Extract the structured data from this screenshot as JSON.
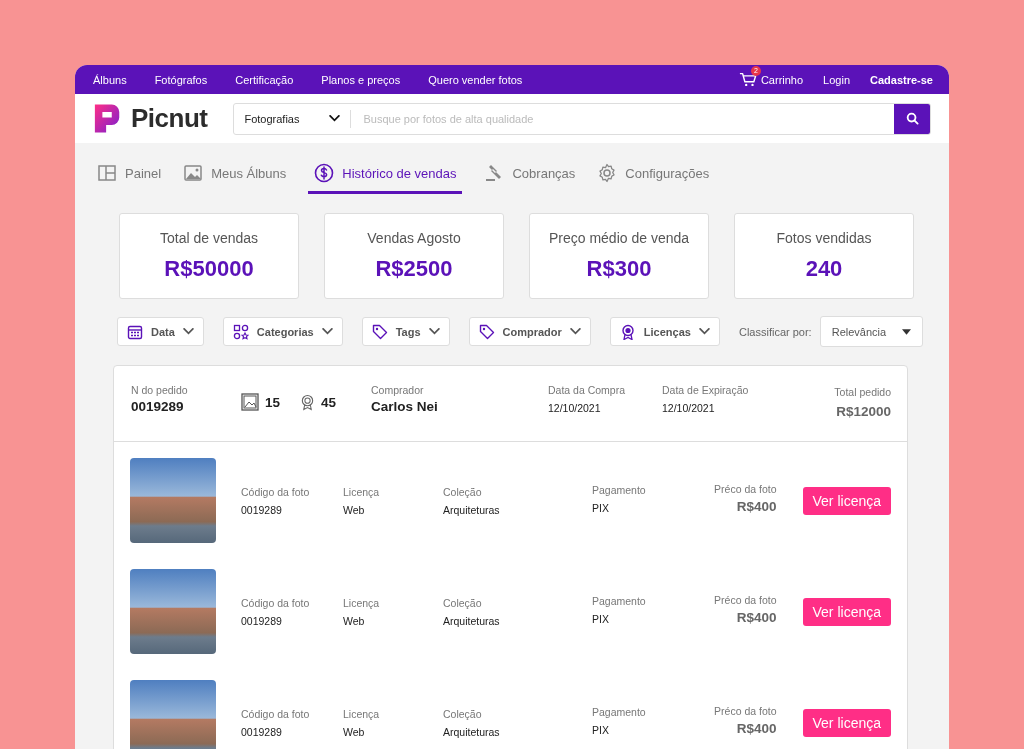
{
  "nav_links": [
    "Álbuns",
    "Fotógrafos",
    "Certificação",
    "Planos e preços",
    "Quero vender fotos"
  ],
  "cart": {
    "label": "Carrinho",
    "badge": "2"
  },
  "login": "Login",
  "signup": "Cadastre-se",
  "logo": "Picnut",
  "search": {
    "category": "Fotografias",
    "placeholder": "Busque por fotos de alta qualidade"
  },
  "tabs": [
    {
      "label": "Painel",
      "kind": "panel",
      "selected": false
    },
    {
      "label": "Meus Álbuns",
      "kind": "album",
      "selected": false
    },
    {
      "label": "Histórico de vendas",
      "kind": "dollar",
      "selected": true
    },
    {
      "label": "Cobranças",
      "kind": "gavel",
      "selected": false
    },
    {
      "label": "Configurações",
      "kind": "gear",
      "selected": false
    }
  ],
  "stats": [
    {
      "label": "Total de vendas",
      "value": "R$50000"
    },
    {
      "label": "Vendas Agosto",
      "value": "R$2500"
    },
    {
      "label": "Preço médio de venda",
      "value": "R$300"
    },
    {
      "label": "Fotos vendidas",
      "value": "240"
    }
  ],
  "filters": [
    {
      "label": "Data",
      "kind": "calendar"
    },
    {
      "label": "Categorias",
      "kind": "shapes"
    },
    {
      "label": "Tags",
      "kind": "tag"
    },
    {
      "label": "Comprador",
      "kind": "tag"
    },
    {
      "label": "Licenças",
      "kind": "award"
    }
  ],
  "sort": {
    "label": "Classificar por:",
    "value": "Relevância"
  },
  "order": {
    "number_label": "N do pedido",
    "number": "0019289",
    "photos": "15",
    "licenses": "45",
    "buyer_label": "Comprador",
    "buyer": "Carlos Nei",
    "purchase_label": "Data da Compra",
    "purchase_date": "12/10/2021",
    "expiry_label": "Data de Expiração",
    "expiry_date": "12/10/2021",
    "total_label": "Total pedido",
    "total": "R$12000"
  },
  "items": [
    {
      "code_label": "Código da foto",
      "code": "0019289",
      "license_label": "Licença",
      "license": "Web",
      "collection_label": "Coleção",
      "collection": "Arquiteturas",
      "payment_label": "Pagamento",
      "payment": "PIX",
      "price_label": "Préco da foto",
      "price": "R$400",
      "button": "Ver licença"
    },
    {
      "code_label": "Código da foto",
      "code": "0019289",
      "license_label": "Licença",
      "license": "Web",
      "collection_label": "Coleção",
      "collection": "Arquiteturas",
      "payment_label": "Pagamento",
      "payment": "PIX",
      "price_label": "Préco da foto",
      "price": "R$400",
      "button": "Ver licença"
    },
    {
      "code_label": "Código da foto",
      "code": "0019289",
      "license_label": "Licença",
      "license": "Web",
      "collection_label": "Coleção",
      "collection": "Arquiteturas",
      "payment_label": "Pagamento",
      "payment": "PIX",
      "price_label": "Préco da foto",
      "price": "R$400",
      "button": "Ver licença"
    }
  ]
}
